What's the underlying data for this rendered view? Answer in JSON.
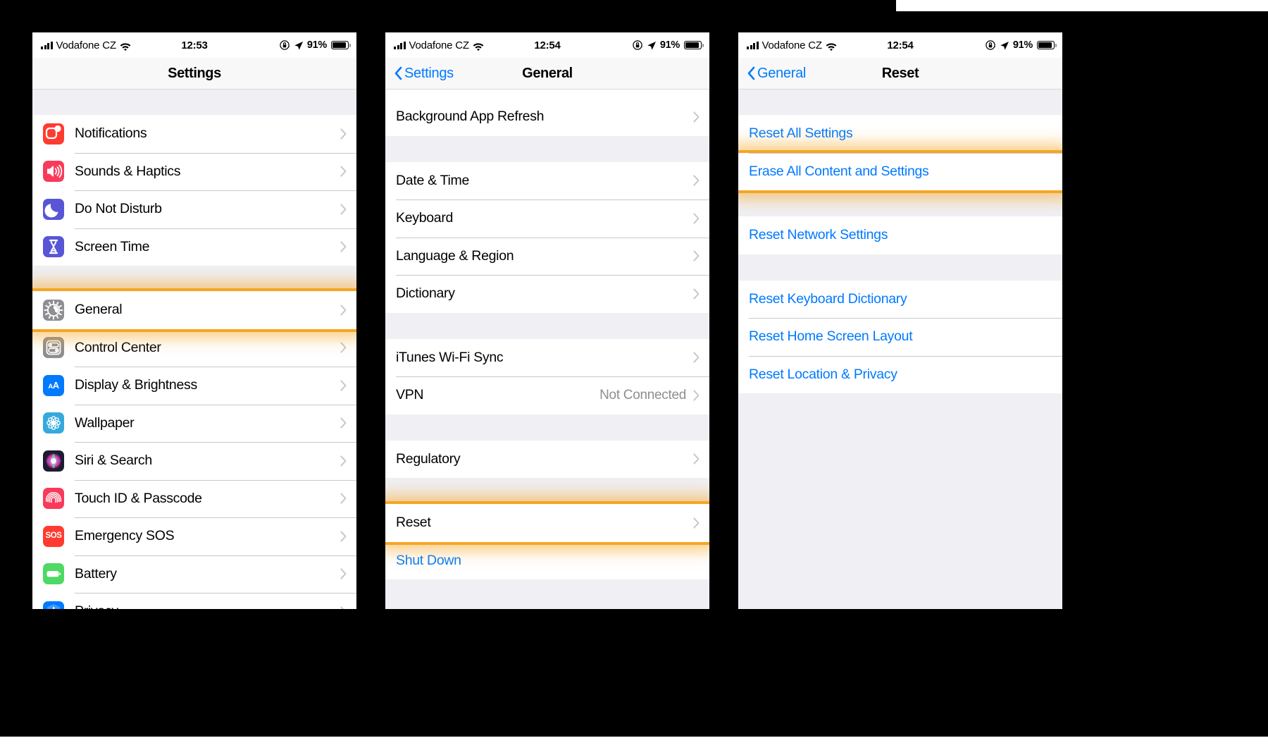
{
  "meta": {
    "accent_highlight": "#f5a623",
    "ios_blue": "#007aff",
    "list_bg": "#efeff4"
  },
  "phones": [
    {
      "id": "settings",
      "status": {
        "carrier": "Vodafone CZ",
        "time": "12:53",
        "battery_pct": "91%",
        "signal_icon": "cellular-bars-icon",
        "wifi_icon": "wifi-icon",
        "rotation_lock_icon": "rotation-lock-icon",
        "location_icon": "location-arrow-icon",
        "battery_icon": "battery-icon"
      },
      "nav": {
        "title": "Settings",
        "back": null
      },
      "groups": [
        {
          "top_gap": 36,
          "rows": [
            {
              "label": "Notifications",
              "icon": "notifications-icon",
              "icon_bg": "#ff3b30",
              "chevron": true
            },
            {
              "label": "Sounds & Haptics",
              "icon": "sounds-icon",
              "icon_bg": "#f93a5a",
              "chevron": true
            },
            {
              "label": "Do Not Disturb",
              "icon": "do-not-disturb-icon",
              "icon_bg": "#5856d6",
              "chevron": true
            },
            {
              "label": "Screen Time",
              "icon": "screen-time-icon",
              "icon_bg": "#5856d6",
              "chevron": true
            }
          ]
        },
        {
          "top_gap": 36,
          "rows": [
            {
              "label": "General",
              "icon": "gear-icon",
              "icon_bg": "#8e8e93",
              "chevron": true,
              "highlighted": true
            },
            {
              "label": "Control Center",
              "icon": "control-center-icon",
              "icon_bg": "#8e8e93",
              "chevron": true
            },
            {
              "label": "Display & Brightness",
              "icon": "display-icon",
              "icon_bg": "#007aff",
              "chevron": true
            },
            {
              "label": "Wallpaper",
              "icon": "wallpaper-icon",
              "icon_bg": "#34aadc",
              "chevron": true
            },
            {
              "label": "Siri & Search",
              "icon": "siri-icon",
              "icon_bg": "#1c1c2e",
              "chevron": true
            },
            {
              "label": "Touch ID & Passcode",
              "icon": "touch-id-icon",
              "icon_bg": "#f93a5a",
              "chevron": true
            },
            {
              "label": "Emergency SOS",
              "icon": "emergency-sos-icon",
              "icon_bg": "#ff3b30",
              "chevron": true
            },
            {
              "label": "Battery",
              "icon": "battery-setting-icon",
              "icon_bg": "#4cd964",
              "chevron": true
            },
            {
              "label": "Privacy",
              "icon": "privacy-icon",
              "icon_bg": "#007aff",
              "chevron": true,
              "clipped": true
            }
          ]
        }
      ]
    },
    {
      "id": "general",
      "status": {
        "carrier": "Vodafone CZ",
        "time": "12:54",
        "battery_pct": "91%",
        "signal_icon": "cellular-bars-icon",
        "wifi_icon": "wifi-icon",
        "rotation_lock_icon": "rotation-lock-icon",
        "location_icon": "location-arrow-icon",
        "battery_icon": "battery-icon"
      },
      "nav": {
        "title": "General",
        "back": "Settings"
      },
      "groups": [
        {
          "top_gap": 0,
          "clipped_top_row": true,
          "rows": [
            {
              "label": "Background App Refresh",
              "chevron": true
            }
          ]
        },
        {
          "top_gap": 37,
          "rows": [
            {
              "label": "Date & Time",
              "chevron": true
            },
            {
              "label": "Keyboard",
              "chevron": true
            },
            {
              "label": "Language & Region",
              "chevron": true
            },
            {
              "label": "Dictionary",
              "chevron": true
            }
          ]
        },
        {
          "top_gap": 37,
          "rows": [
            {
              "label": "iTunes Wi-Fi Sync",
              "chevron": true
            },
            {
              "label": "VPN",
              "value": "Not Connected",
              "chevron": true
            }
          ]
        },
        {
          "top_gap": 37,
          "rows": [
            {
              "label": "Regulatory",
              "chevron": true
            }
          ]
        },
        {
          "top_gap": 37,
          "rows": [
            {
              "label": "Reset",
              "chevron": true,
              "highlighted": true
            },
            {
              "label": "Shut Down",
              "blue": true
            }
          ]
        }
      ]
    },
    {
      "id": "reset",
      "status": {
        "carrier": "Vodafone CZ",
        "time": "12:54",
        "battery_pct": "91%",
        "signal_icon": "cellular-bars-icon",
        "wifi_icon": "wifi-icon",
        "rotation_lock_icon": "rotation-lock-icon",
        "location_icon": "location-arrow-icon",
        "battery_icon": "battery-icon"
      },
      "nav": {
        "title": "Reset",
        "back": "General"
      },
      "groups": [
        {
          "top_gap": 36,
          "rows": [
            {
              "label": "Reset All Settings",
              "blue": true
            },
            {
              "label": "Erase All Content and Settings",
              "blue": true,
              "highlighted": true
            }
          ]
        },
        {
          "top_gap": 37,
          "rows": [
            {
              "label": "Reset Network Settings",
              "blue": true
            }
          ]
        },
        {
          "top_gap": 37,
          "rows": [
            {
              "label": "Reset Keyboard Dictionary",
              "blue": true
            },
            {
              "label": "Reset Home Screen Layout",
              "blue": true
            },
            {
              "label": "Reset Location & Privacy",
              "blue": true
            }
          ]
        }
      ]
    }
  ]
}
